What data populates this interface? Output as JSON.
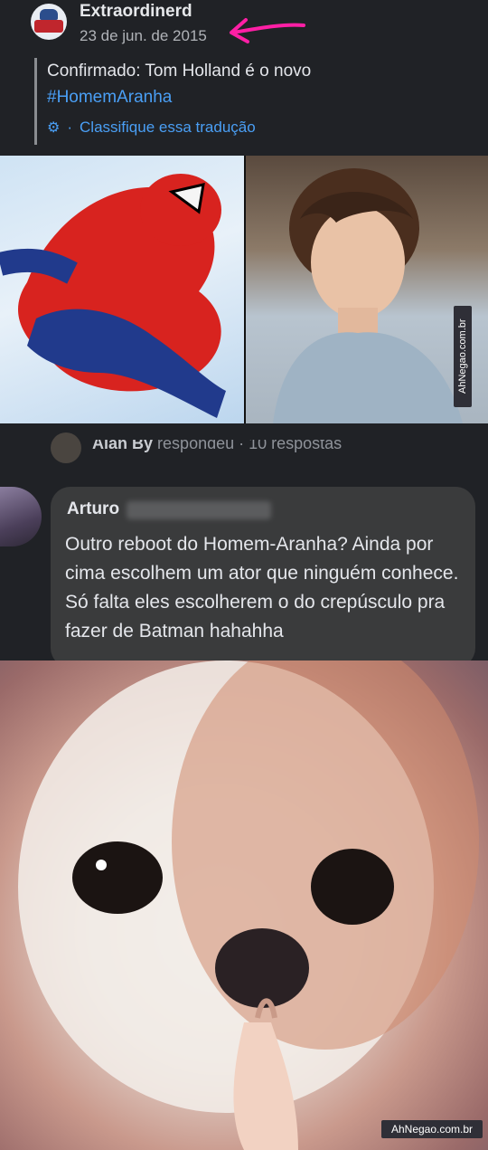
{
  "post": {
    "page_name": "Extraordinerd",
    "date": "23 de jun. de 2015",
    "text": "Confirmado: Tom Holland é o novo",
    "hashtag": "#HomemAranha",
    "translate_label": "Classifique essa tradução"
  },
  "replies": {
    "summary_name": "Alan By",
    "summary_text": "respondeu · 10 respostas"
  },
  "comment": {
    "author": "Arturo",
    "text": "Outro reboot do Homem-Aranha? Ainda por cima escolhem um ator que ninguém conhece. Só falta eles escolherem o do crepúsculo pra fazer de Batman hahahha"
  },
  "watermarks": {
    "side": "AhNegao.com.br",
    "bottom": "AhNegao.com.br"
  },
  "colors": {
    "accent_link": "#4a9ff5",
    "arrow": "#ff1fa5"
  }
}
